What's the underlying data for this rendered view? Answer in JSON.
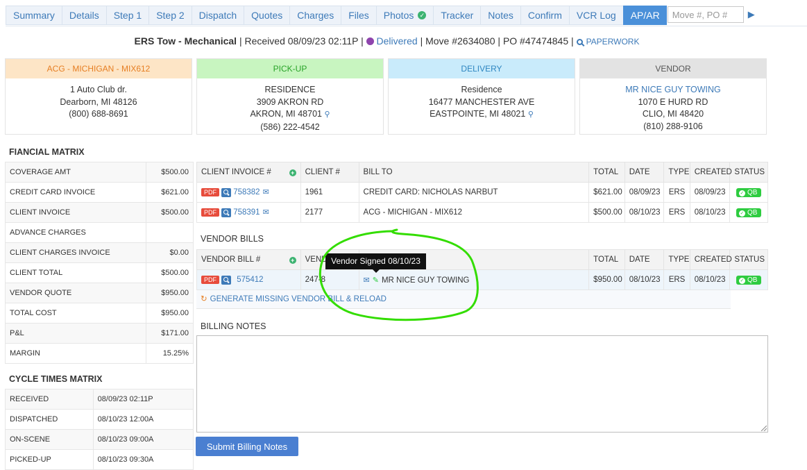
{
  "tabs": [
    {
      "label": "Summary",
      "active": false
    },
    {
      "label": "Details",
      "active": false
    },
    {
      "label": "Step 1",
      "active": false
    },
    {
      "label": "Step 2",
      "active": false
    },
    {
      "label": "Dispatch",
      "active": false
    },
    {
      "label": "Quotes",
      "active": false
    },
    {
      "label": "Charges",
      "active": false
    },
    {
      "label": "Files",
      "active": false
    },
    {
      "label": "Photos",
      "active": false
    },
    {
      "label": "Tracker",
      "active": false
    },
    {
      "label": "Notes",
      "active": false
    },
    {
      "label": "Confirm",
      "active": false
    },
    {
      "label": "VCR Log",
      "active": false
    },
    {
      "label": "AP/AR",
      "active": true
    }
  ],
  "search": {
    "placeholder": "Move #, PO #"
  },
  "header": {
    "service": "ERS Tow - Mechanical",
    "received": "Received 08/09/23 02:11P",
    "status": "Delivered",
    "move": "Move #2634080",
    "po": "PO #47474845",
    "paperwork": "PAPERWORK",
    "sep": "|"
  },
  "cards": {
    "client": {
      "title": "ACG - MICHIGAN - MIX612",
      "line1": "1 Auto Club dr.",
      "line2": "Dearborn, MI 48126",
      "line3": "(800) 688-8691"
    },
    "pickup": {
      "title": "PICK-UP",
      "line1": "RESIDENCE",
      "line2": "3909 AKRON RD",
      "line3": "AKRON, MI 48701",
      "line4": "(586) 222-4542"
    },
    "delivery": {
      "title": "DELIVERY",
      "line1": "Residence",
      "line2": "16477 MANCHESTER AVE",
      "line3": "EASTPOINTE, MI 48021"
    },
    "vendor": {
      "title": "VENDOR",
      "line1": "MR NICE GUY TOWING",
      "line2": "1070 E HURD RD",
      "line3": "CLIO, MI 48420",
      "line4": "(810) 288-9106"
    }
  },
  "financial": {
    "title": "FIANCIAL MATRIX",
    "rows": [
      {
        "label": "COVERAGE AMT",
        "value": "$500.00"
      },
      {
        "label": "CREDIT CARD INVOICE",
        "value": "$621.00"
      },
      {
        "label": "CLIENT INVOICE",
        "value": "$500.00"
      },
      {
        "label": "ADVANCE CHARGES",
        "value": ""
      },
      {
        "label": "CLIENT CHARGES INVOICE",
        "value": "$0.00"
      },
      {
        "label": "CLIENT TOTAL",
        "value": "$500.00"
      },
      {
        "label": "VENDOR QUOTE",
        "value": "$950.00"
      },
      {
        "label": "TOTAL COST",
        "value": "$950.00"
      },
      {
        "label": "P&L",
        "value": "$171.00"
      },
      {
        "label": "MARGIN",
        "value": "15.25%"
      }
    ]
  },
  "cycle": {
    "title": "CYCLE TIMES MATRIX",
    "rows": [
      {
        "label": "RECEIVED",
        "value": "08/09/23 02:11P"
      },
      {
        "label": "DISPATCHED",
        "value": "08/10/23 12:00A"
      },
      {
        "label": "ON-SCENE",
        "value": "08/10/23 09:00A"
      },
      {
        "label": "PICKED-UP",
        "value": "08/10/23 09:30A"
      }
    ]
  },
  "client_invoices": {
    "headers": {
      "invoice": "CLIENT INVOICE #",
      "client": "CLIENT #",
      "bill_to": "BILL TO",
      "total": "TOTAL",
      "date": "DATE",
      "type": "TYPE",
      "created": "CREATED",
      "status": "STATUS"
    },
    "rows": [
      {
        "pdf": "PDF",
        "invoice": "758382",
        "client": "1961",
        "bill_to": "CREDIT CARD: NICHOLAS NARBUT",
        "total": "$621.00",
        "date": "08/09/23",
        "type": "ERS",
        "created": "08/09/23",
        "status": "QB"
      },
      {
        "pdf": "PDF",
        "invoice": "758391",
        "client": "2177",
        "bill_to": "ACG - MICHIGAN - MIX612",
        "total": "$500.00",
        "date": "08/10/23",
        "type": "ERS",
        "created": "08/10/23",
        "status": "QB"
      }
    ]
  },
  "vendor_bills": {
    "title": "VENDOR BILLS",
    "headers": {
      "bill": "VENDOR BILL #",
      "vendor": "VEND",
      "total": "TOTAL",
      "date": "DATE",
      "type": "TYPE",
      "created": "CREATED",
      "status": "STATUS"
    },
    "rows": [
      {
        "pdf": "PDF",
        "bill": "575412",
        "vendor": "247-8",
        "name": "MR NICE GUY TOWING",
        "total": "$950.00",
        "date": "08/10/23",
        "type": "ERS",
        "created": "08/10/23",
        "status": "QB"
      }
    ],
    "generate": "GENERATE MISSING VENDOR BILL & RELOAD",
    "tooltip": "Vendor Signed 08/10/23"
  },
  "billing_notes": {
    "title": "BILLING NOTES",
    "value": "",
    "submit": "Submit Billing Notes"
  },
  "colors": {
    "accent": "#4a90d9",
    "link": "#3d7ab8",
    "qb": "#2ecc40",
    "pdf": "#e74c3c",
    "annotation": "#33dd00",
    "client_hdr": "#fde5c6",
    "pickup_hdr": "#c8f5c0",
    "delivery_hdr": "#c9ebfb",
    "vendor_hdr": "#e3e3e3"
  }
}
